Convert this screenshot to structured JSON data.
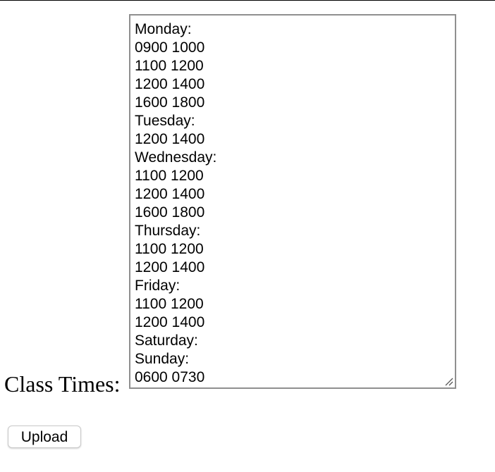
{
  "form": {
    "class_times_label": "Class Times:",
    "class_times_lines": [
      "Monday:",
      "0900 1000",
      "1100 1200",
      "1200 1400",
      "1600 1800",
      "Tuesday:",
      "1200 1400",
      "Wednesday:",
      "1100 1200",
      "1200 1400",
      "1600 1800",
      "Thursday:",
      "1100 1200",
      "1200 1400",
      "Friday:",
      "1100 1200",
      "1200 1400",
      "Saturday:",
      "Sunday:",
      "0600 0730"
    ],
    "upload_label": "Upload"
  },
  "icons": {
    "resize_grip": "resize-grip-icon"
  },
  "colors": {
    "textarea_border": "#8f8f8f",
    "button_border": "#c9c9c9"
  }
}
